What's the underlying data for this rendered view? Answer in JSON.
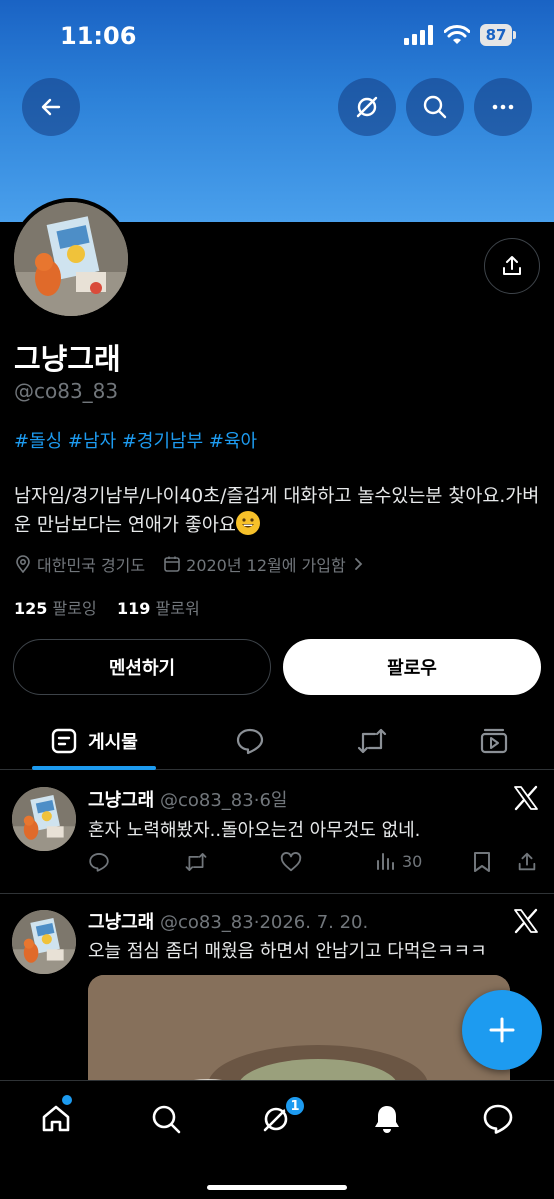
{
  "status_bar": {
    "time": "11:06",
    "battery": "87"
  },
  "profile": {
    "name": "그냥그래",
    "handle": "@co83_83",
    "tags": "#돌싱 #남자 #경기남부 #육아",
    "bio": "남자임/경기남부/나이40초/즐겁게 대화하고 놀수있는분 찾아요.가벼운 만남보다는 연애가 좋아요",
    "location": "대한민국 경기도",
    "joined": "2020년 12월에 가입함",
    "following_count": "125",
    "following_label": "팔로잉",
    "followers_count": "119",
    "followers_label": "팔로워"
  },
  "buttons": {
    "mention": "멘션하기",
    "follow": "팔로우"
  },
  "tabs": {
    "posts": "게시물"
  },
  "posts": [
    {
      "name": "그냥그래",
      "handle": "@co83_83",
      "sep": "·",
      "time": "6일",
      "text": "혼자 노력해봤자..돌아오는건 아무것도 없네.",
      "views": "30"
    },
    {
      "name": "그냥그래",
      "handle": "@co83_83",
      "sep": "·",
      "time": "2026. 7. 20.",
      "text": "오늘 점심 좀더 매웠음 하면서 안남기고 다먹은ㅋㅋㅋ"
    }
  ],
  "nav": {
    "messages_badge": "1"
  },
  "colors": {
    "accent": "#1d9bf0",
    "banner_top": "#1a63c4",
    "banner_bottom": "#4aa0ec"
  }
}
